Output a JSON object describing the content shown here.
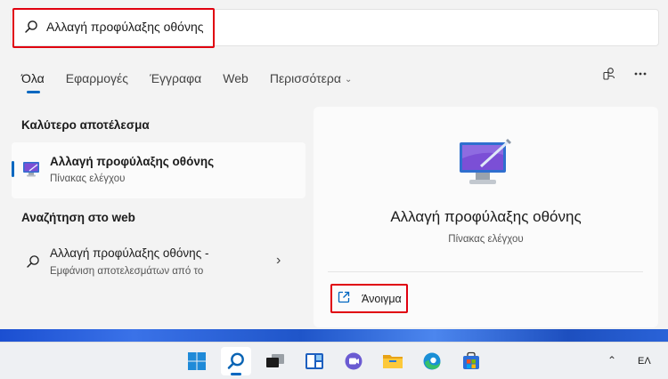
{
  "search": {
    "query": "Αλλαγή προφύλαξης οθόνης",
    "icon": "search-icon"
  },
  "tabs": [
    {
      "label": "Όλα",
      "active": true
    },
    {
      "label": "Εφαρμογές",
      "active": false
    },
    {
      "label": "Έγγραφα",
      "active": false
    },
    {
      "label": "Web",
      "active": false
    },
    {
      "label": "Περισσότερα",
      "active": false
    }
  ],
  "header_icons": [
    "account-switch-icon",
    "more-options-icon"
  ],
  "best_match": {
    "section_title": "Καλύτερο αποτέλεσμα",
    "title": "Αλλαγή προφύλαξης οθόνης",
    "subtitle": "Πίνακας ελέγχου",
    "icon": "screensaver-monitor-icon"
  },
  "web_search": {
    "section_title": "Αναζήτηση στο web",
    "title": "Αλλαγή προφύλαξης οθόνης -",
    "subtitle": "Εμφάνιση αποτελεσμάτων από το"
  },
  "detail": {
    "title": "Αλλαγή προφύλαξης οθόνης",
    "subtitle": "Πίνακας ελέγχου",
    "open_label": "Άνοιγμα"
  },
  "taskbar": {
    "apps": [
      "windows-start-icon",
      "search-icon",
      "task-view-icon",
      "widgets-icon",
      "teams-chat-icon",
      "file-explorer-icon",
      "edge-browser-icon",
      "store-icon"
    ],
    "language": "ΕΛ"
  },
  "colors": {
    "accent": "#0067c0",
    "highlight": "#e0000f",
    "panel_bg": "#f3f3f3"
  }
}
